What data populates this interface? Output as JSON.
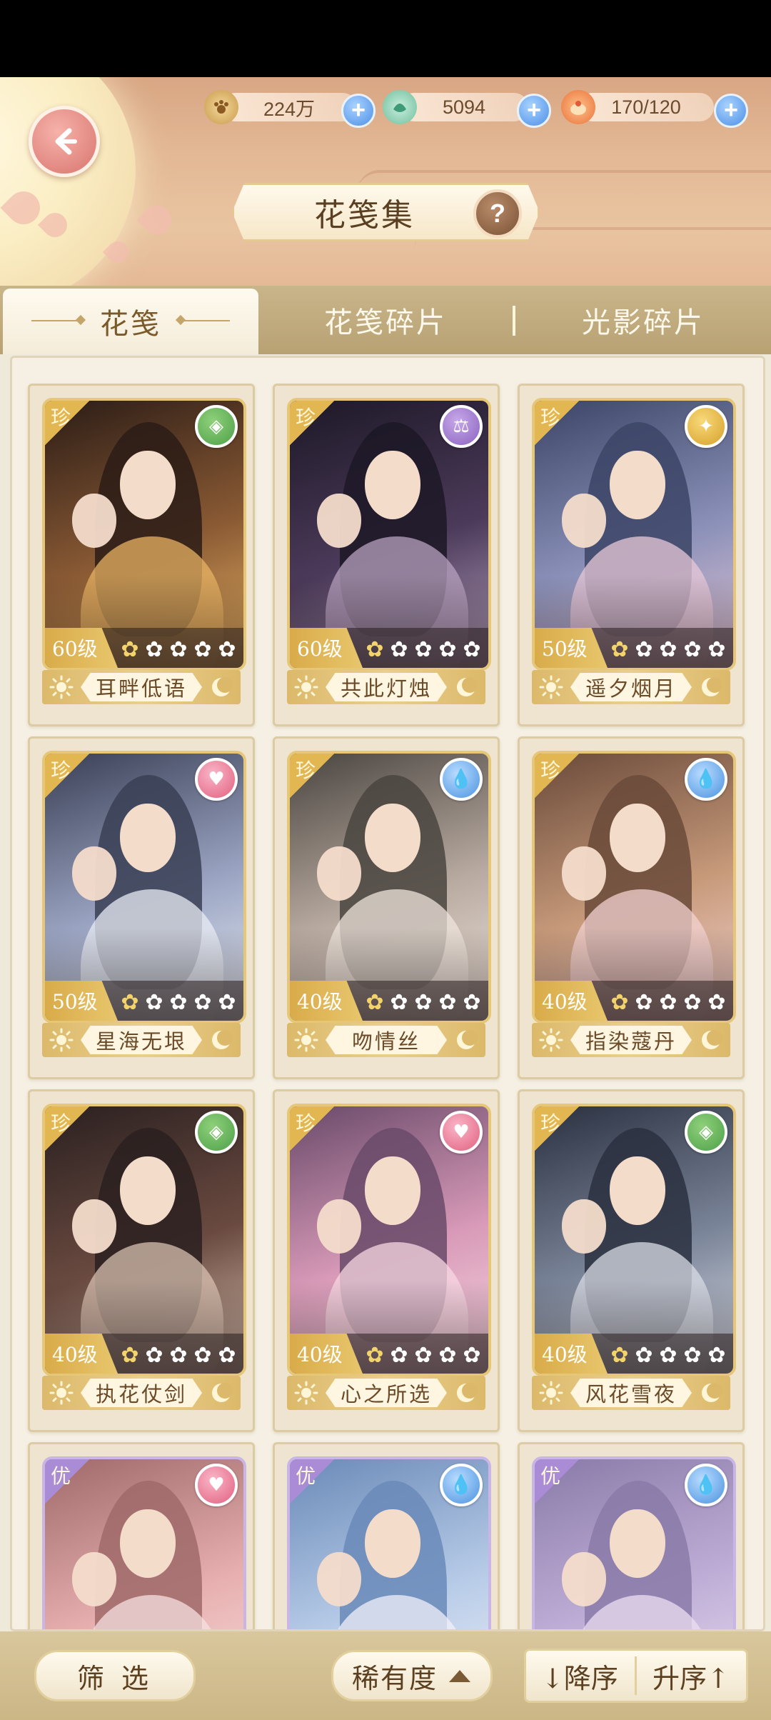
{
  "header": {
    "title": "花笺集",
    "resources": [
      {
        "icon": "paw-coin-icon",
        "value": "224万"
      },
      {
        "icon": "jade-icon",
        "value": "5094"
      },
      {
        "icon": "stamina-bun-icon",
        "value": "170/120"
      }
    ]
  },
  "tabs": [
    {
      "label": "花笺",
      "active": true
    },
    {
      "label": "花笺碎片",
      "active": false
    },
    {
      "label": "光影碎片",
      "active": false
    }
  ],
  "cards": [
    {
      "rarity": "珍",
      "level": "60级",
      "stars": 1,
      "name": "耳畔低语",
      "element": "green-diamond"
    },
    {
      "rarity": "珍",
      "level": "60级",
      "stars": 1,
      "name": "共此灯烛",
      "element": "purple-scale"
    },
    {
      "rarity": "珍",
      "level": "50级",
      "stars": 1,
      "name": "遥夕烟月",
      "element": "gold-wing"
    },
    {
      "rarity": "珍",
      "level": "50级",
      "stars": 1,
      "name": "星海无垠",
      "element": "pink-heart"
    },
    {
      "rarity": "珍",
      "level": "40级",
      "stars": 1,
      "name": "吻情丝",
      "element": "blue-drop"
    },
    {
      "rarity": "珍",
      "level": "40级",
      "stars": 1,
      "name": "指染蔻丹",
      "element": "blue-drop"
    },
    {
      "rarity": "珍",
      "level": "40级",
      "stars": 1,
      "name": "执花仗剑",
      "element": "green-diamond"
    },
    {
      "rarity": "珍",
      "level": "40级",
      "stars": 1,
      "name": "心之所选",
      "element": "pink-heart"
    },
    {
      "rarity": "珍",
      "level": "40级",
      "stars": 1,
      "name": "风花雪夜",
      "element": "green-diamond"
    },
    {
      "rarity": "优",
      "level": "",
      "stars": 0,
      "name": "",
      "element": "pink-heart"
    },
    {
      "rarity": "优",
      "level": "",
      "stars": 0,
      "name": "",
      "element": "blue-drop"
    },
    {
      "rarity": "优",
      "level": "",
      "stars": 0,
      "name": "",
      "element": "blue-drop"
    }
  ],
  "bottom": {
    "filter_label": "筛 选",
    "rarity_label": "稀有度",
    "desc_label": "↓降序",
    "asc_label": "升序↑"
  },
  "colors": {
    "gold_rarity": "#e2b651",
    "purple_rarity": "#a98bd6",
    "accent_plus": "#4d8fe6"
  }
}
